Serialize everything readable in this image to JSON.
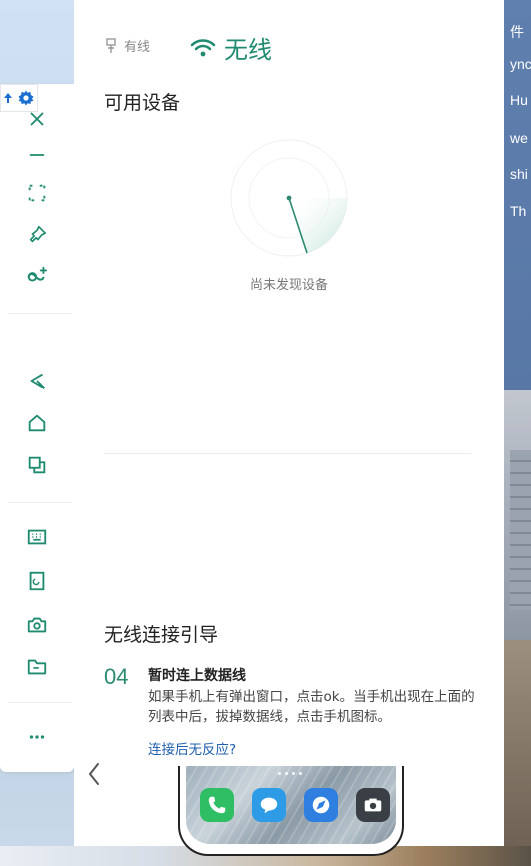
{
  "background": {
    "right_texts": [
      "件",
      "ync",
      "Hu",
      "we",
      "shi",
      "Th"
    ]
  },
  "toolbar": {
    "buttons": [
      {
        "name": "close-icon",
        "label": "关闭"
      },
      {
        "name": "minimize-icon",
        "label": "最小化"
      },
      {
        "name": "fullscreen-icon",
        "label": "全屏"
      },
      {
        "name": "pin-icon",
        "label": "置顶"
      },
      {
        "name": "multi-screen-icon",
        "label": "多屏"
      },
      {
        "name": "back-icon",
        "label": "返回"
      },
      {
        "name": "home-icon",
        "label": "主页"
      },
      {
        "name": "recent-apps-icon",
        "label": "多任务"
      },
      {
        "name": "keyboard-icon",
        "label": "键盘"
      },
      {
        "name": "screen-lock-icon",
        "label": "锁屏"
      },
      {
        "name": "screenshot-icon",
        "label": "截屏"
      },
      {
        "name": "folder-icon",
        "label": "文件"
      },
      {
        "name": "more-icon",
        "label": "更多"
      }
    ],
    "accent_color": "#1e8a6f"
  },
  "panel": {
    "tab_wired": "有线",
    "tab_wireless": "无线",
    "available_devices_title": "可用设备",
    "empty_state": "尚未发现设备",
    "guide_title": "无线连接引导",
    "step": {
      "number": "04",
      "title": "暂时连上数据线",
      "description": "如果手机上有弹出窗口，点击ok。当手机出现在上面的列表中后，拔掉数据线，点击手机图标。",
      "help_link": "连接后无反应?"
    }
  },
  "phone": {
    "apps": [
      "phone-app-icon",
      "messages-app-icon",
      "browser-app-icon",
      "camera-app-icon"
    ]
  }
}
